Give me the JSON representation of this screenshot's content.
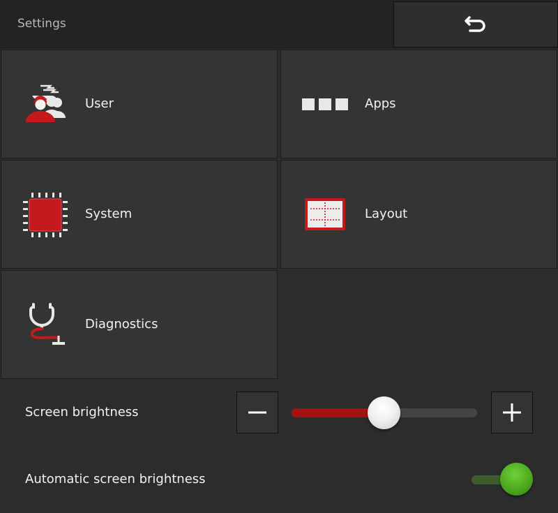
{
  "header": {
    "title": "Settings",
    "back_icon": "undo-arrow-icon"
  },
  "tiles": [
    {
      "label": "User",
      "icon": "user-group-icon"
    },
    {
      "label": "Apps",
      "icon": "apps-icon"
    },
    {
      "label": "System",
      "icon": "chip-icon"
    },
    {
      "label": "Layout",
      "icon": "layout-icon"
    },
    {
      "label": "Diagnostics",
      "icon": "stethoscope-icon"
    }
  ],
  "brightness": {
    "label": "Screen brightness",
    "level": 0.5,
    "decrease_icon": "minus-icon",
    "increase_icon": "plus-icon"
  },
  "auto_brightness": {
    "label": "Automatic screen brightness",
    "enabled": true
  },
  "colors": {
    "accent_red": "#a81114",
    "toggle_green": "#4aa51d"
  }
}
